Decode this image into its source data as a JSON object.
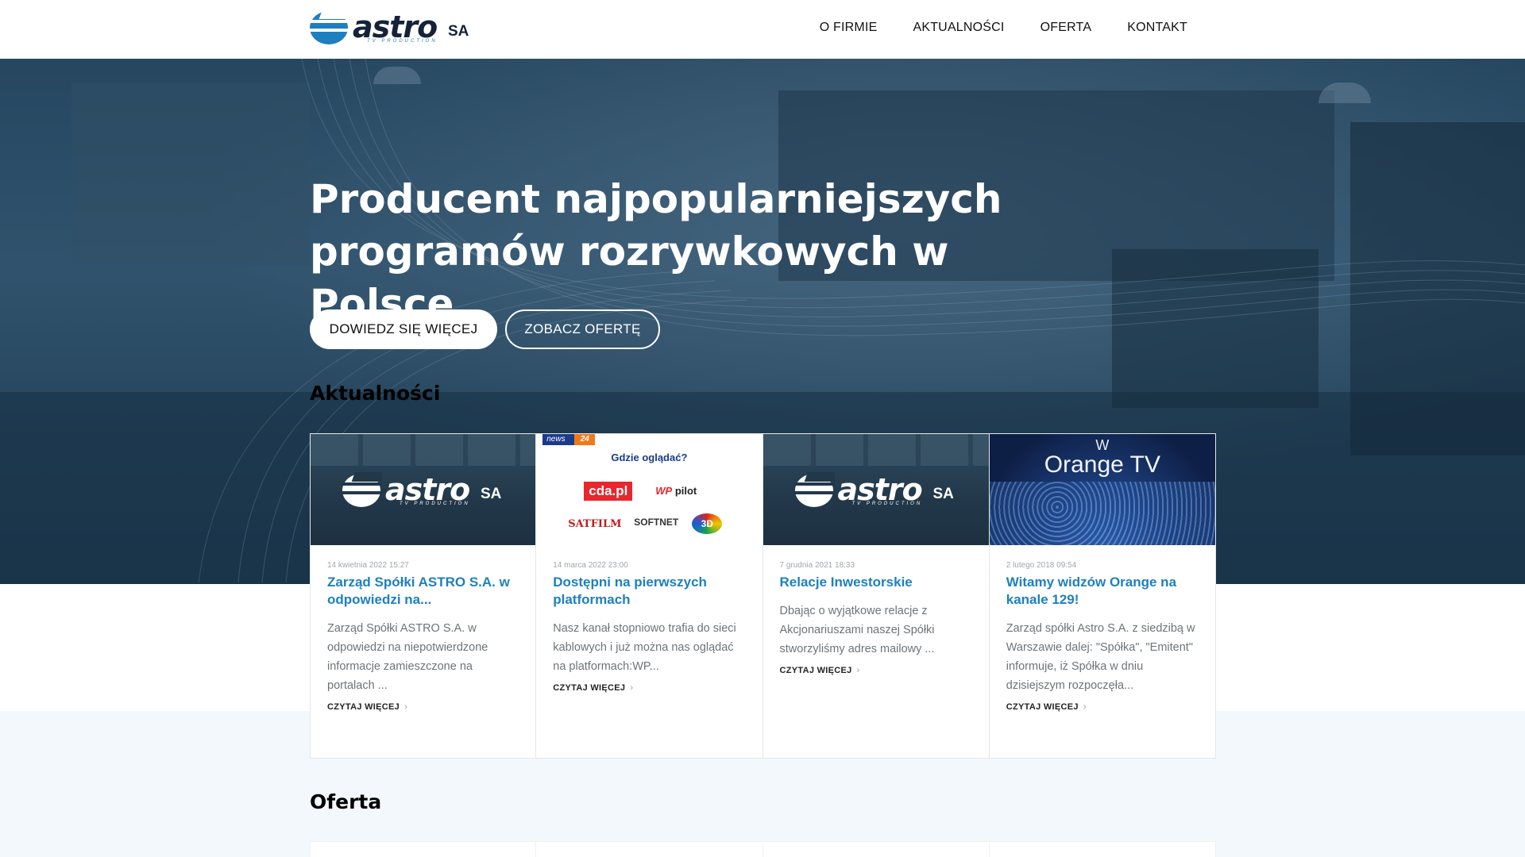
{
  "header": {
    "logo": {
      "word": "astro",
      "suffix": "SA",
      "tagline": "TV PRODUCTION"
    },
    "nav": [
      {
        "label": "O FIRMIE"
      },
      {
        "label": "AKTUALNOŚCI"
      },
      {
        "label": "OFERTA"
      },
      {
        "label": "KONTAKT"
      }
    ]
  },
  "hero": {
    "title_line1": "Producent najpopularniejszych",
    "title_line2": "programów rozrywkowych w Polsce",
    "primary_button": "DOWIEDZ SIĘ WIĘCEJ",
    "secondary_button": "ZOBACZ OFERTĘ"
  },
  "news": {
    "title": "Aktualności",
    "cards": [
      {
        "image": "astro-logo",
        "date": "14 kwietnia 2022 15:27",
        "title": "Zarząd Spółki ASTRO S.A. w odpowiedzi na...",
        "excerpt": "Zarząd Spółki ASTRO S.A. w odpowiedzi na niepotwierdzone informacje zamieszczone na portalach ...",
        "more": "CZYTAJ WIĘCEJ"
      },
      {
        "image": "platforms",
        "date": "14 marca 2022 23:00",
        "title": "Dostępni na pierwszych platformach",
        "excerpt": "Nasz kanał stopniowo trafia do sieci kablowych i już można nas oglądać na platformach:WP...",
        "more": "CZYTAJ WIĘCEJ"
      },
      {
        "image": "astro-logo",
        "date": "7 grudnia 2021 18:33",
        "title": "Relacje Inwestorskie",
        "excerpt": "Dbając o wyjątkowe relacje z Akcjonariuszami naszej Spółki stworzyliśmy adres mailowy ...",
        "more": "CZYTAJ WIĘCEJ"
      },
      {
        "image": "orange-tv",
        "date": "2 lutego 2018 09:54",
        "title": "Witamy widzów Orange na kanale 129!",
        "excerpt": "Zarząd spółki Astro S.A. z siedzibą w Warszawie dalej: \"Spółka\", \"Emitent\" informuje, iż Spółka w dniu dzisiejszym rozpoczęła...",
        "more": "CZYTAJ WIĘCEJ"
      }
    ],
    "platforms_image": {
      "badge_left": "news",
      "badge_right": "24",
      "heading": "Gdzie oglądać?",
      "logos": [
        "cda.pl",
        "WP",
        "pilot",
        "SATFILM",
        "SOFTNET",
        "3D"
      ]
    },
    "orange_image": {
      "line1": "W",
      "line2": "Orange TV"
    }
  },
  "offer": {
    "title": "Oferta"
  },
  "colors": {
    "accent": "#1e80bd",
    "hero_tint": "#2c4d66",
    "band": "#f3f8fc"
  }
}
